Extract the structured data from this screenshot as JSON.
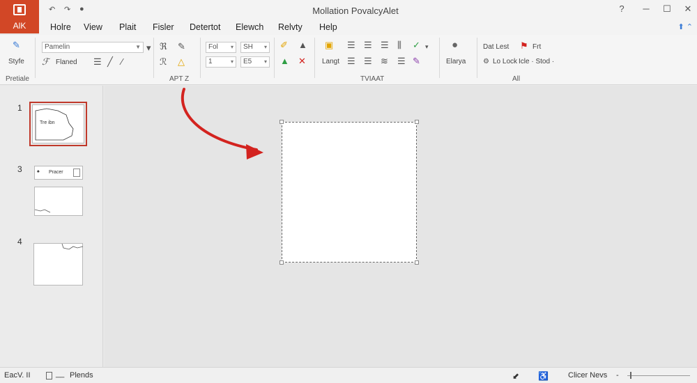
{
  "app": {
    "badge_label": "AlK",
    "title": "Mollation PovalcyAlet"
  },
  "quick_access": {
    "undo": "↶",
    "redo": "↷",
    "info": "●"
  },
  "window_controls": {
    "help": "?",
    "minimize": "─",
    "maximize": "☐",
    "close": "✕"
  },
  "menu": {
    "tabs": [
      "Holre",
      "View",
      "Plait",
      "Fisler",
      "Detertot",
      "Elewch",
      "Relvty",
      "Help"
    ]
  },
  "ribbon": {
    "style_label": "Styfe",
    "font_name": "Pamelin",
    "font_size": "Fol",
    "font_size2": "SH",
    "num1": "1",
    "num2": "E5",
    "format_label": "Flaned",
    "layout_label": "Langt",
    "design_label": "Elarya",
    "dat_lest": "Dat Lest",
    "fit": "Frt",
    "lo_lock": "Lo Lock",
    "icle_stod": "Icle · Stod ·",
    "groups": [
      "Pretiale",
      "APT Z",
      "TVIAAT",
      "All"
    ]
  },
  "slides": [
    {
      "number": "1",
      "caption": "Tre ibn"
    },
    {
      "number": "3",
      "caption": "Pracer"
    },
    {
      "number": "4"
    }
  ],
  "status": {
    "slide_info": "EacV. II",
    "notes": "Plends",
    "view_mode": "Clicer Nevs"
  },
  "colors": {
    "accent": "#d24726",
    "arrow": "#d3231f",
    "selection": "#c0392b"
  }
}
